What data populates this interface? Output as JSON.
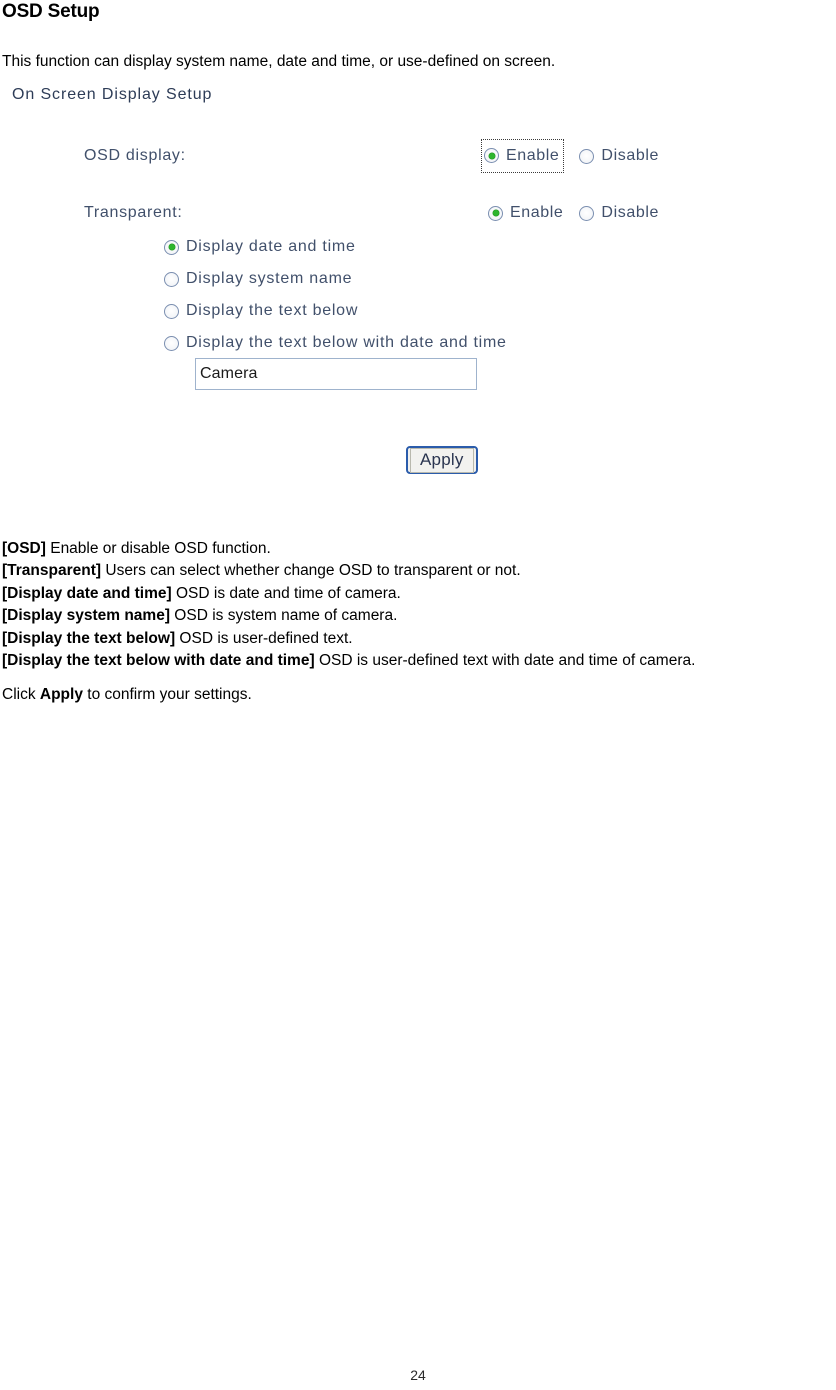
{
  "document": {
    "title": "OSD Setup",
    "intro": "This function can display system name, date and time, or use-defined on screen.",
    "page_number": "24"
  },
  "form": {
    "panel_heading": "On Screen Display Setup",
    "heading_color": "#2d3c57",
    "label_color": "#41506b",
    "selected_dot_color": "#2db52d",
    "rows": [
      {
        "label": "OSD display:",
        "options": [
          {
            "label": "Enable",
            "selected": true,
            "focused": true
          },
          {
            "label": "Disable",
            "selected": false,
            "focused": false
          }
        ]
      },
      {
        "label": "Transparent:",
        "options": [
          {
            "label": "Enable",
            "selected": true,
            "focused": false
          },
          {
            "label": "Disable",
            "selected": false,
            "focused": false
          }
        ]
      }
    ],
    "display_mode_options": [
      {
        "label": "Display date and time",
        "selected": true
      },
      {
        "label": "Display system name",
        "selected": false
      },
      {
        "label": "Display the text below",
        "selected": false
      },
      {
        "label": "Display the text below with date and time",
        "selected": false
      }
    ],
    "text_field": {
      "value": "Camera",
      "placeholder": ""
    },
    "apply_button": {
      "label": "Apply",
      "focus_border_color": "#2b5cab"
    }
  },
  "descriptions": [
    {
      "term": "[OSD]",
      "text": " Enable or disable OSD function."
    },
    {
      "term": "[Transparent]",
      "text": " Users can select whether change OSD to transparent or not."
    },
    {
      "term": "[Display date and time]",
      "text": " OSD is date and time of camera."
    },
    {
      "term": "[Display system name]",
      "text": " OSD is system name of camera."
    },
    {
      "term": "[Display the text below]",
      "text": " OSD is user-defined text."
    },
    {
      "term": "[Display the text below with date and time]",
      "text": " OSD is user-defined text with date and time of camera."
    }
  ],
  "click_hint": {
    "before": "Click ",
    "bold": "Apply",
    "after": " to confirm your settings."
  }
}
